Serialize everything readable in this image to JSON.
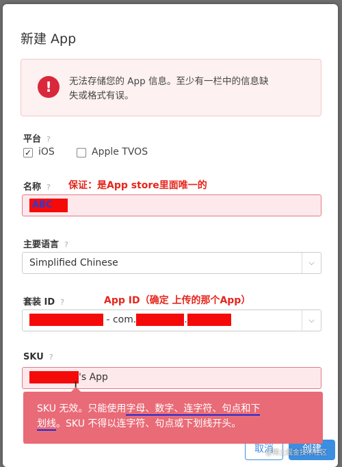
{
  "dialog": {
    "title": "新建 App"
  },
  "error": {
    "icon": "exclamation-icon",
    "message_line1": "无法存储您的 App 信息。至少有一栏中的信息缺",
    "message_line2": "失或格式有误。"
  },
  "platform": {
    "label": "平台",
    "help": "?",
    "options": [
      {
        "label": "iOS",
        "checked": true
      },
      {
        "label": "Apple TVOS",
        "checked": false
      }
    ]
  },
  "name": {
    "label": "名称",
    "help": "?",
    "annotation": "保证：是App store里面唯一的",
    "value": "ABC"
  },
  "language": {
    "label": "主要语言",
    "help": "?",
    "value": "Simplified Chinese"
  },
  "bundle": {
    "label": "套装 ID",
    "help": "?",
    "annotation": "App ID（确定 上传的那个App）",
    "value_middle": " - com.",
    "value_dot": "."
  },
  "sku": {
    "label": "SKU",
    "help": "?",
    "value_suffix": "'s App"
  },
  "tooltip": {
    "part1": "SKU 无效。只能使用",
    "part2": "字母、数字、连字符、句点和下",
    "part3": "划线",
    "part4": "。SKU 不得以连字符、句点或下划线开头。"
  },
  "buttons": {
    "cancel": "取消",
    "create": "创建"
  },
  "watermark": "@稀土掘金技术社区",
  "colors": {
    "accent": "#3c8ee0",
    "error": "#d9283b",
    "annotation": "#e5261c",
    "redaction": "#f50a0a"
  }
}
